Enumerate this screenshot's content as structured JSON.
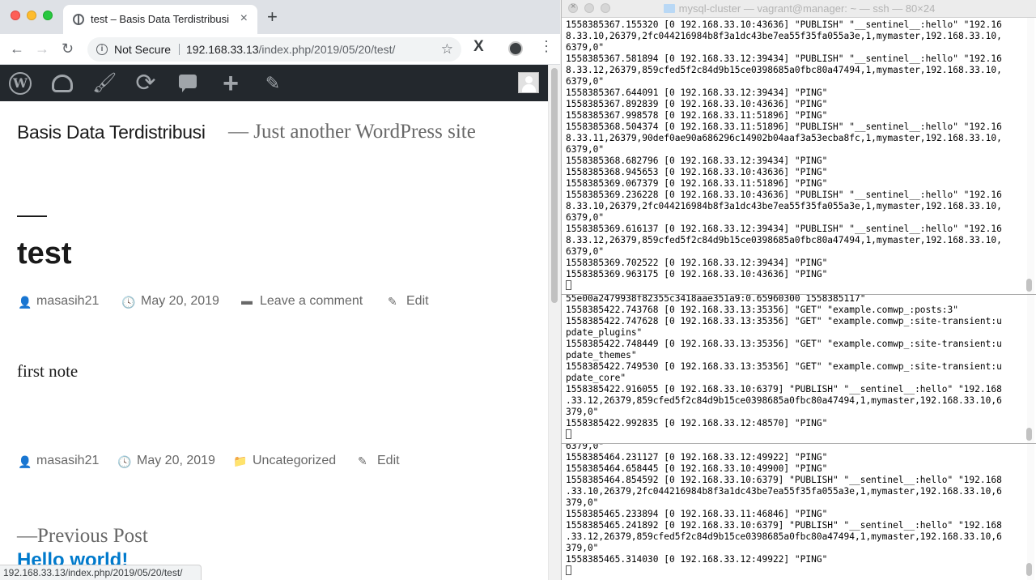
{
  "browser": {
    "tab": {
      "title": "test – Basis Data Terdistribusi",
      "close_glyph": "×"
    },
    "new_tab_glyph": "+",
    "nav": {
      "back_glyph": "←",
      "forward_glyph": "→",
      "reload_glyph": "↻"
    },
    "omnibox": {
      "info_glyph": "i",
      "security_label": "Not Secure",
      "url_host": "192.168.33.13",
      "url_path": "/index.php/2019/05/20/test/",
      "star_glyph": "☆"
    },
    "extension_label": "X",
    "menu_glyph": "⋮",
    "status_url": "192.168.33.13/index.php/2019/05/20/test/"
  },
  "adminbar": {
    "wp_letter": "W",
    "brush_glyph": "🖌",
    "updates_glyph": "⟳",
    "new_glyph": "+",
    "edit_glyph": "✎"
  },
  "site": {
    "title": "Basis Data Terdistribusi",
    "description": "— Just another WordPress site"
  },
  "post": {
    "title": "test",
    "meta_top": {
      "author": "masasih21",
      "date": "May 20, 2019",
      "comment_link": "Leave a comment",
      "edit_link": "Edit"
    },
    "content": "first note",
    "meta_bottom": {
      "author": "masasih21",
      "date": "May 20, 2019",
      "category": "Uncategorized",
      "edit_link": "Edit"
    },
    "nav": {
      "previous_label": "—Previous Post",
      "previous_title": "Hello world!"
    }
  },
  "icons": {
    "author": "👤",
    "clock": "🕓",
    "comment": "▬",
    "pencil": "✎",
    "folder": "📁"
  },
  "terminals": [
    {
      "title": "mysql-cluster — vagrant@manager: ~ — ssh — 80×24",
      "lines": [
        "1558385367.155320 [0 192.168.33.10:43636] \"PUBLISH\" \"__sentinel__:hello\" \"192.16",
        "8.33.10,26379,2fc044216984b8f3a1dc43be7ea55f35fa055a3e,1,mymaster,192.168.33.10,",
        "6379,0\"",
        "1558385367.581894 [0 192.168.33.12:39434] \"PUBLISH\" \"__sentinel__:hello\" \"192.16",
        "8.33.12,26379,859cfed5f2c84d9b15ce0398685a0fbc80a47494,1,mymaster,192.168.33.10,",
        "6379,0\"",
        "1558385367.644091 [0 192.168.33.12:39434] \"PING\"",
        "1558385367.892839 [0 192.168.33.10:43636] \"PING\"",
        "1558385367.998578 [0 192.168.33.11:51896] \"PING\"",
        "1558385368.504374 [0 192.168.33.11:51896] \"PUBLISH\" \"__sentinel__:hello\" \"192.16",
        "8.33.11,26379,90def0ae90a686296c14902b04aaf3a53ecba8fc,1,mymaster,192.168.33.10,",
        "6379,0\"",
        "1558385368.682796 [0 192.168.33.12:39434] \"PING\"",
        "1558385368.945653 [0 192.168.33.10:43636] \"PING\"",
        "1558385369.067379 [0 192.168.33.11:51896] \"PING\"",
        "1558385369.236228 [0 192.168.33.10:43636] \"PUBLISH\" \"__sentinel__:hello\" \"192.16",
        "8.33.10,26379,2fc044216984b8f3a1dc43be7ea55f35fa055a3e,1,mymaster,192.168.33.10,",
        "6379,0\"",
        "1558385369.616137 [0 192.168.33.12:39434] \"PUBLISH\" \"__sentinel__:hello\" \"192.16",
        "8.33.12,26379,859cfed5f2c84d9b15ce0398685a0fbc80a47494,1,mymaster,192.168.33.10,",
        "6379,0\"",
        "1558385369.702522 [0 192.168.33.12:39434] \"PING\"",
        "1558385369.963175 [0 192.168.33.10:43636] \"PING\""
      ]
    },
    {
      "lines": [
        "55e00a2479938f82355c3418aae351a9:0.65960300 1558385117\"",
        "1558385422.743768 [0 192.168.33.13:35356] \"GET\" \"example.comwp_:posts:3\"",
        "1558385422.747628 [0 192.168.33.13:35356] \"GET\" \"example.comwp_:site-transient:u",
        "pdate_plugins\"",
        "1558385422.748449 [0 192.168.33.13:35356] \"GET\" \"example.comwp_:site-transient:u",
        "pdate_themes\"",
        "1558385422.749530 [0 192.168.33.13:35356] \"GET\" \"example.comwp_:site-transient:u",
        "pdate_core\"",
        "1558385422.916055 [0 192.168.33.10:6379] \"PUBLISH\" \"__sentinel__:hello\" \"192.168",
        ".33.12,26379,859cfed5f2c84d9b15ce0398685a0fbc80a47494,1,mymaster,192.168.33.10,6",
        "379,0\"",
        "1558385422.992835 [0 192.168.33.12:48570] \"PING\""
      ]
    },
    {
      "lines": [
        "6379,0\"",
        "1558385464.231127 [0 192.168.33.12:49922] \"PING\"",
        "1558385464.658445 [0 192.168.33.10:49900] \"PING\"",
        "1558385464.854592 [0 192.168.33.10:6379] \"PUBLISH\" \"__sentinel__:hello\" \"192.168",
        ".33.10,26379,2fc044216984b8f3a1dc43be7ea55f35fa055a3e,1,mymaster,192.168.33.10,6",
        "379,0\"",
        "1558385465.233894 [0 192.168.33.11:46846] \"PING\"",
        "1558385465.241892 [0 192.168.33.10:6379] \"PUBLISH\" \"__sentinel__:hello\" \"192.168",
        ".33.12,26379,859cfed5f2c84d9b15ce0398685a0fbc80a47494,1,mymaster,192.168.33.10,6",
        "379,0\"",
        "1558385465.314030 [0 192.168.33.12:49922] \"PING\""
      ]
    }
  ],
  "colors": {
    "wp_link": "#007acc",
    "admin_bar": "#23282d",
    "chrome_tabstrip": "#dee1e6"
  }
}
